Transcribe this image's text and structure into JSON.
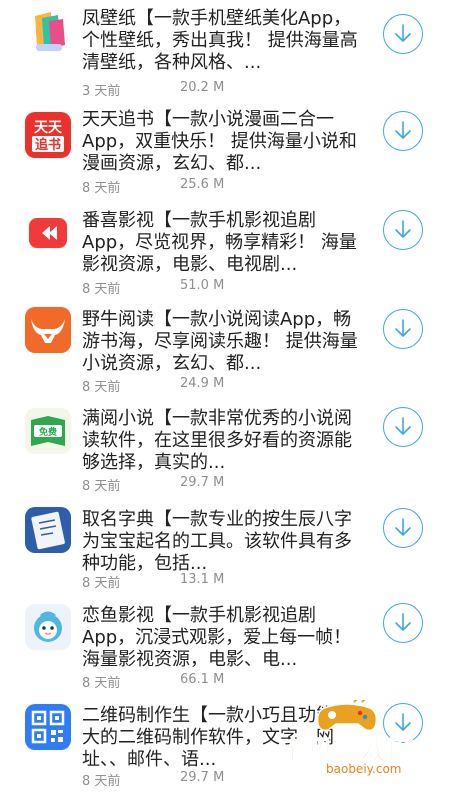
{
  "apps": [
    {
      "name": "凤壁纸",
      "icon": "wallpaper-app-icon",
      "desc_lines": [
        "凤壁纸【一款手机壁纸美化App，",
        "个性壁纸，秀出真我！ 提供海量高",
        "清壁纸，各种风格、..."
      ],
      "time": "3 天前",
      "size": "20.2 M"
    },
    {
      "name": "天天追书",
      "icon": "book-chase-app-icon",
      "icon_text": [
        "天天",
        "追书"
      ],
      "desc_lines": [
        "天天追书【一款小说漫画二合一",
        "App，双重快乐！ 提供海量小说和",
        "漫画资源，玄幻、都..."
      ],
      "time": "8 天前",
      "size": "25.6 M"
    },
    {
      "name": "番喜影视",
      "icon": "video-play-app-icon",
      "desc_lines": [
        "番喜影视【一款手机影视追剧",
        "App，尽览视界，畅享精彩！ 海量",
        "影视资源，电影、电视剧..."
      ],
      "time": "8 天前",
      "size": "51.0 M"
    },
    {
      "name": "野牛阅读",
      "icon": "bison-reading-app-icon",
      "desc_lines": [
        "野牛阅读【一款小说阅读App，畅",
        "游书海，尽享阅读乐趣！ 提供海量",
        "小说资源，玄幻、都..."
      ],
      "time": "8 天前",
      "size": "24.9 M"
    },
    {
      "name": "满阅小说",
      "icon": "free-novel-app-icon",
      "icon_text": [
        "免费"
      ],
      "desc_lines": [
        "满阅小说【一款非常优秀的小说阅",
        "读软件，在这里很多好看的资源能",
        "够选择，真实的..."
      ],
      "time": "8 天前",
      "size": "29.7 M"
    },
    {
      "name": "取名字典",
      "icon": "name-dictionary-app-icon",
      "desc_lines": [
        "取名字典【一款专业的按生辰八字",
        "为宝宝起名的工具。该软件具有多",
        "种功能，包括..."
      ],
      "time": "8 天前",
      "size": "13.1 M"
    },
    {
      "name": "恋鱼影视",
      "icon": "fish-video-app-icon",
      "desc_lines": [
        "恋鱼影视【一款手机影视追剧",
        "App，沉浸式观影，爱上每一帧！",
        "海量影视资源，电影、电..."
      ],
      "time": "8 天前",
      "size": "66.1 M"
    },
    {
      "name": "二维码制作生",
      "icon": "qr-code-app-icon",
      "desc_lines": [
        "二维码制作生【一款小巧且功能强",
        "大的二维码制作软件，文字、网",
        "址、、邮件、语..."
      ],
      "time": "8 天前",
      "size": "29.7 M"
    }
  ],
  "download_icon": "download-arrow-icon",
  "watermark": {
    "text": "宝贝游戏网",
    "url": "baobeiy.com",
    "icon": "gamepad-logo-icon"
  },
  "colors": {
    "accent": "#41a6e4",
    "meta_text": "#8f8f8f",
    "body_text": "#222222",
    "watermark": "#f7941e"
  }
}
